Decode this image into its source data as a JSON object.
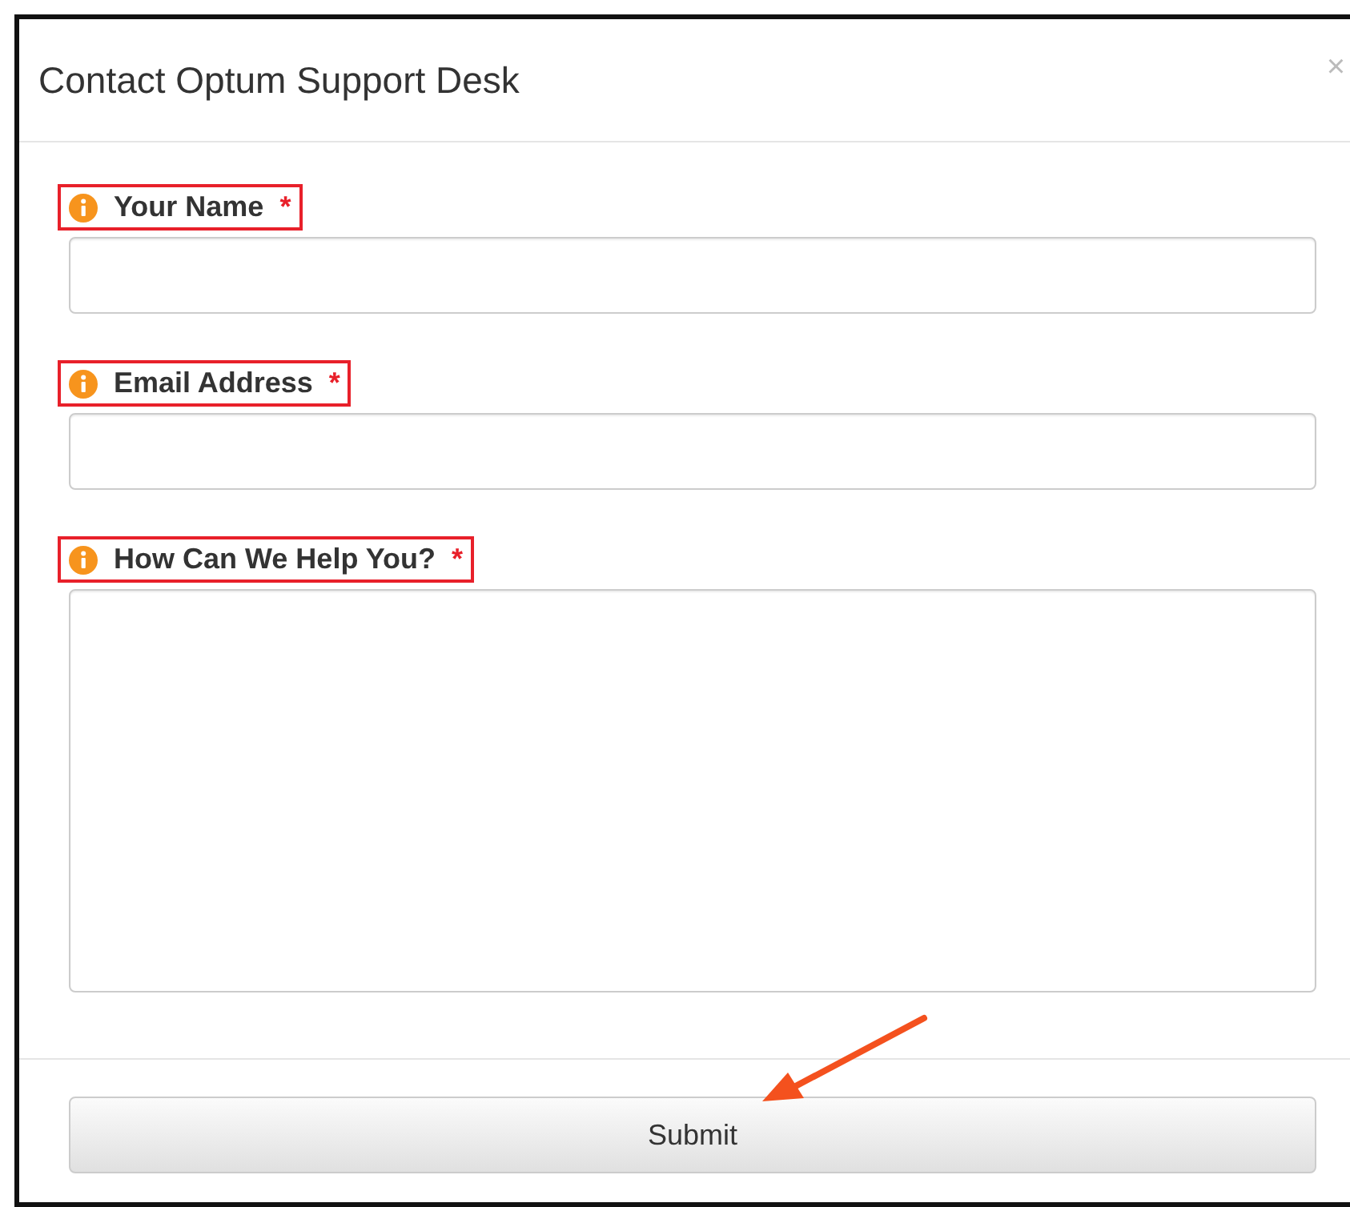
{
  "dialog": {
    "title": "Contact Optum Support Desk",
    "close": "×"
  },
  "fields": [
    {
      "label": "Your Name",
      "required": "*",
      "kind": "input",
      "highlighted": true
    },
    {
      "label": "Email Address",
      "required": "*",
      "kind": "input",
      "highlighted": true
    },
    {
      "label": "How Can We Help You?",
      "required": "*",
      "kind": "textarea",
      "highlighted": true
    }
  ],
  "submit": {
    "label": "Submit"
  }
}
